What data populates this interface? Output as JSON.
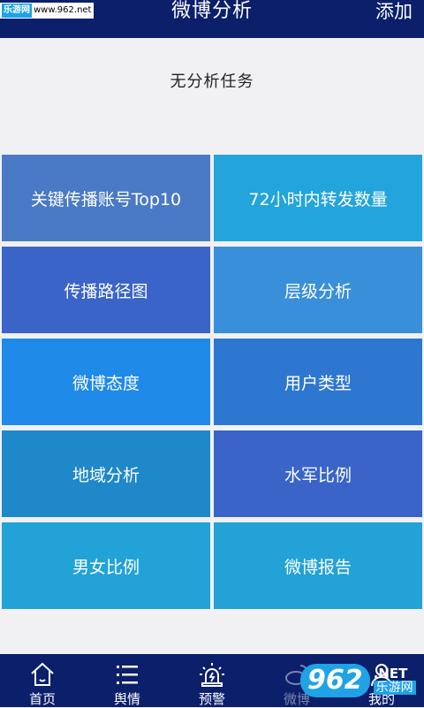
{
  "watermark": {
    "site": "乐游网",
    "url": "www.962.net"
  },
  "header": {
    "title": "微博分析",
    "add_label": "添加"
  },
  "empty_state": {
    "text": "无分析任务"
  },
  "tiles": [
    {
      "label": "关键传播账号Top10",
      "color": "#4a7ac5"
    },
    {
      "label": "72小时内转发数量",
      "color": "#23a4dc"
    },
    {
      "label": "传播路径图",
      "color": "#3a64c8"
    },
    {
      "label": "层级分析",
      "color": "#3a8fda"
    },
    {
      "label": "微博态度",
      "color": "#1f8ae8"
    },
    {
      "label": "用户类型",
      "color": "#2e77d0"
    },
    {
      "label": "地域分析",
      "color": "#1f88c8"
    },
    {
      "label": "水军比例",
      "color": "#3a64c8"
    },
    {
      "label": "男女比例",
      "color": "#22a2d6"
    },
    {
      "label": "微博报告",
      "color": "#22a2d6"
    }
  ],
  "tabs": [
    {
      "label": "首页",
      "icon": "home-icon"
    },
    {
      "label": "舆情",
      "icon": "list-icon"
    },
    {
      "label": "预警",
      "icon": "alarm-icon"
    },
    {
      "label": "微博",
      "icon": "weibo-icon",
      "active": true
    },
    {
      "label": "我的",
      "icon": "user-icon"
    }
  ],
  "badge": {
    "logo": "962",
    "net": ".NET",
    "cn": "乐游网"
  }
}
